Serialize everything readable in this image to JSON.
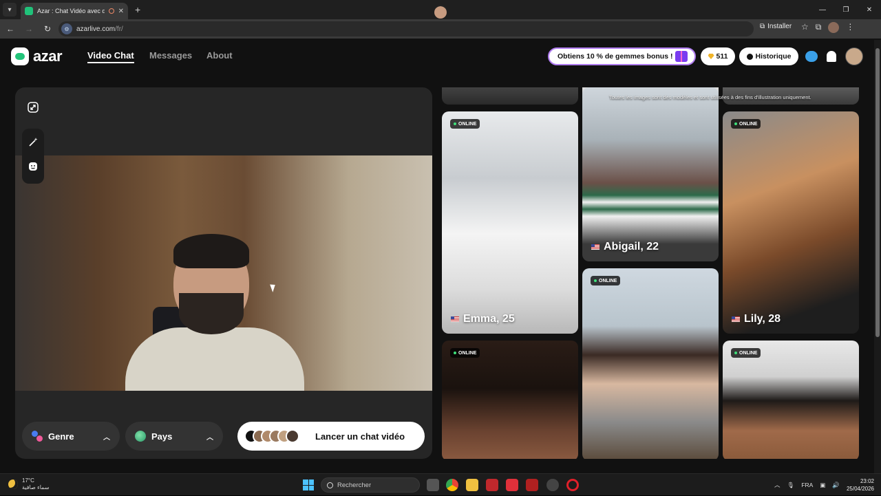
{
  "browser": {
    "tab_title": "Azar : Chat Vidéo avec de n",
    "url_host": "azarlive.com",
    "url_path": "/fr/",
    "install_label": "Installer"
  },
  "header": {
    "logo_text": "azar",
    "nav": [
      "Video Chat",
      "Messages",
      "About"
    ],
    "promo_text": "Obtiens 10 % de gemmes bonus !",
    "gem_count": "511",
    "history_label": "Historique"
  },
  "video_panel": {
    "gender_label": "Genre",
    "country_label": "Pays",
    "start_label": "Lancer un chat vidéo"
  },
  "gallery": {
    "disclaimer": "Toutes les images sont des modèles et sont utilisées à des fins d'illustration uniquement.",
    "online_label": "ONLINE",
    "profiles": [
      {
        "name": "Emma, 25",
        "online": true
      },
      {
        "name": "Abigail, 22",
        "online": false
      },
      {
        "name": "Lily, 28",
        "online": true
      },
      {
        "name": "",
        "online": true
      },
      {
        "name": "",
        "online": true
      },
      {
        "name": "",
        "online": true
      }
    ]
  },
  "taskbar": {
    "temperature": "17°C",
    "weather_desc": "سماء صافية",
    "search_placeholder": "Rechercher",
    "language": "FRA",
    "time": "23:02",
    "date": "25/04/2026"
  },
  "colors": {
    "accent_green": "#22c47a",
    "promo_border": "#b07cf0",
    "online_dot": "#3ee07a"
  }
}
